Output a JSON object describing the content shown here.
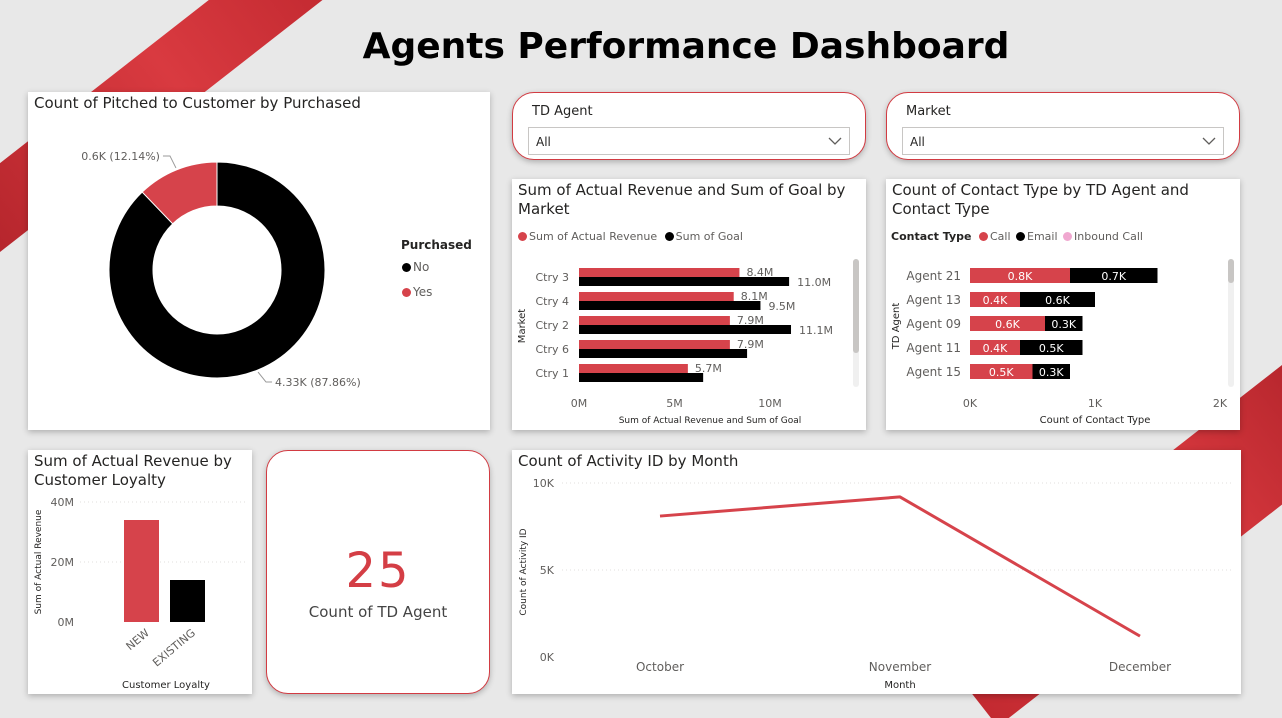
{
  "page_title": "Agents Performance Dashboard",
  "colors": {
    "accent": "#d6434b",
    "black": "#000000",
    "pink": "#f0a8d0",
    "background": "#e8e8e8"
  },
  "slicers": [
    {
      "label": "TD Agent",
      "value": "All",
      "icon": "chevron-down-icon"
    },
    {
      "label": "Market",
      "value": "All",
      "icon": "chevron-down-icon"
    }
  ],
  "donut": {
    "title": "Count of Pitched to Customer by Purchased",
    "legend_title": "Purchased",
    "slices": [
      {
        "name": "No",
        "value": 4330,
        "label": "4.33K (87.86%)",
        "color": "#000000"
      },
      {
        "name": "Yes",
        "value": 600,
        "label": "0.6K (12.14%)",
        "color": "#d6434b"
      }
    ]
  },
  "market_chart": {
    "title": "Sum of Actual Revenue and Sum of Goal by Market",
    "legend": [
      {
        "name": "Sum of Actual Revenue",
        "color": "#d6434b"
      },
      {
        "name": "Sum of Goal",
        "color": "#000000"
      }
    ],
    "ylabel": "Market",
    "xlabel": "Sum of Actual Revenue and Sum of Goal",
    "x_ticks": [
      "0M",
      "5M",
      "10M"
    ]
  },
  "contact_chart": {
    "title": "Count of Contact Type by TD Agent and Contact Type",
    "legend_title": "Contact Type",
    "legend": [
      {
        "name": "Call",
        "color": "#d6434b"
      },
      {
        "name": "Email",
        "color": "#000000"
      },
      {
        "name": "Inbound Call",
        "color": "#f0a8d0"
      }
    ],
    "ylabel": "TD Agent",
    "xlabel": "Count of Contact Type",
    "x_ticks": [
      "0K",
      "1K",
      "2K"
    ]
  },
  "loyalty_chart": {
    "title": "Sum of Actual Revenue by Customer Loyalty",
    "ylabel": "Sum of Actual Revenue",
    "xlabel": "Customer Loyalty",
    "y_ticks": [
      "40M",
      "20M",
      "0M"
    ]
  },
  "kpi": {
    "value": "25",
    "label": "Count of TD Agent"
  },
  "activity_chart": {
    "title": "Count of Activity ID by Month",
    "ylabel": "Count of Activity ID",
    "xlabel": "Month",
    "y_ticks": [
      "10K",
      "5K",
      "0K"
    ]
  },
  "chart_data": [
    {
      "type": "pie",
      "title": "Count of Pitched to Customer by Purchased",
      "categories": [
        "No",
        "Yes"
      ],
      "values": [
        4330,
        600
      ],
      "labels": [
        "4.33K (87.86%)",
        "0.6K (12.14%)"
      ],
      "legend_position": "right"
    },
    {
      "type": "bar",
      "title": "Sum of Actual Revenue and Sum of Goal by Market",
      "orientation": "horizontal",
      "categories": [
        "Ctry 3",
        "Ctry 4",
        "Ctry 2",
        "Ctry 6",
        "Ctry 1"
      ],
      "series": [
        {
          "name": "Sum of Actual Revenue",
          "values": [
            8.4,
            8.1,
            7.9,
            7.9,
            5.7
          ],
          "labels": [
            "8.4M",
            "8.1M",
            "7.9M",
            "7.9M",
            "5.7M"
          ]
        },
        {
          "name": "Sum of Goal",
          "values": [
            11.0,
            9.5,
            11.1,
            8.8,
            6.5
          ],
          "labels": [
            "11.0M",
            "9.5M",
            "11.1M",
            "",
            ""
          ]
        }
      ],
      "xlim": [
        0,
        12
      ],
      "xlabel": "Sum of Actual Revenue and Sum of Goal",
      "ylabel": "Market"
    },
    {
      "type": "bar",
      "title": "Count of Contact Type by TD Agent and Contact Type",
      "orientation": "horizontal",
      "stacked": true,
      "categories": [
        "Agent 21",
        "Agent 13",
        "Agent 09",
        "Agent 11",
        "Agent 15"
      ],
      "series": [
        {
          "name": "Call",
          "values": [
            0.8,
            0.4,
            0.6,
            0.4,
            0.5
          ],
          "labels": [
            "0.8K",
            "0.4K",
            "0.6K",
            "0.4K",
            "0.5K"
          ]
        },
        {
          "name": "Email",
          "values": [
            0.7,
            0.6,
            0.3,
            0.5,
            0.3
          ],
          "labels": [
            "0.7K",
            "0.6K",
            "0.3K",
            "0.5K",
            "0.3K"
          ]
        },
        {
          "name": "Inbound Call",
          "values": [
            0,
            0,
            0,
            0,
            0
          ],
          "labels": [
            "",
            "",
            "",
            "",
            ""
          ]
        }
      ],
      "xlim": [
        0,
        2
      ],
      "xlabel": "Count of Contact Type",
      "ylabel": "TD Agent"
    },
    {
      "type": "bar",
      "title": "Sum of Actual Revenue by Customer Loyalty",
      "categories": [
        "NEW",
        "EXISTING"
      ],
      "values": [
        34,
        14
      ],
      "ylim": [
        0,
        40
      ],
      "xlabel": "Customer Loyalty",
      "ylabel": "Sum of Actual Revenue"
    },
    {
      "type": "line",
      "title": "Count of Activity ID by Month",
      "categories": [
        "October",
        "November",
        "December"
      ],
      "values": [
        8100,
        9200,
        1200
      ],
      "ylim": [
        0,
        10000
      ],
      "xlabel": "Month",
      "ylabel": "Count of Activity ID"
    }
  ]
}
